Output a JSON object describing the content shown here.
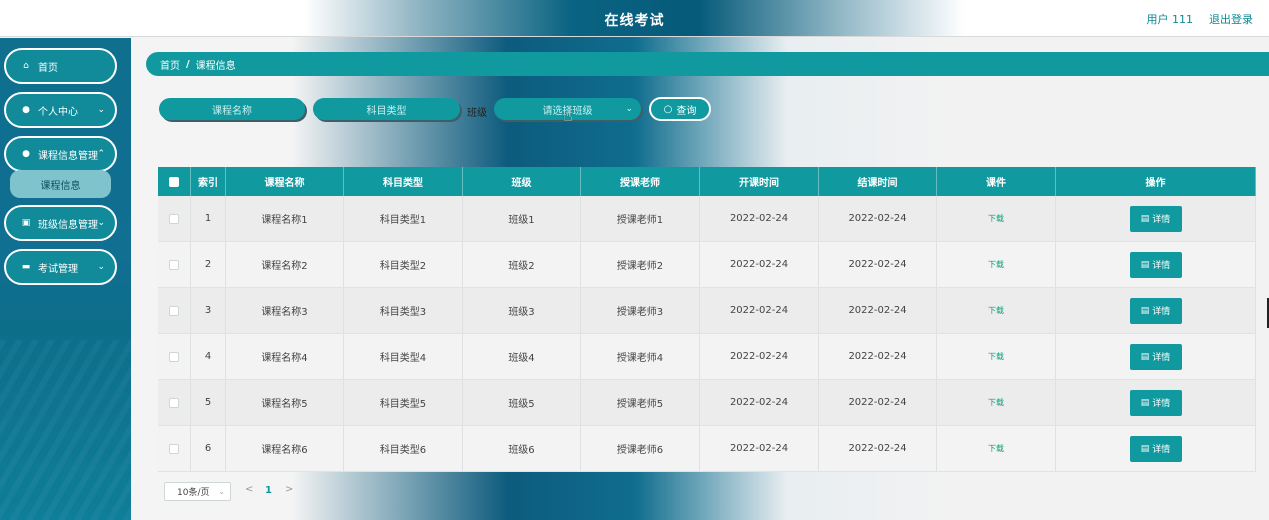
{
  "header": {
    "title": "在线考试",
    "user": "用户 111",
    "logout": "退出登录"
  },
  "sidebar": {
    "items": [
      {
        "label": "首页",
        "icon": "home-icon"
      },
      {
        "label": "个人中心",
        "icon": "user-icon"
      },
      {
        "label": "课程信息管理",
        "icon": "user-icon"
      },
      {
        "label": "班级信息管理",
        "icon": "clipboard-icon"
      },
      {
        "label": "考试管理",
        "icon": "briefcase-icon"
      }
    ],
    "sub_item": "课程信息"
  },
  "breadcrumb": {
    "home": "首页",
    "sep": "/",
    "current": "课程信息"
  },
  "search": {
    "course_name_placeholder": "课程名称",
    "subject_type_placeholder": "科目类型",
    "class_label": "班级",
    "class_select_placeholder": "请选择班级",
    "query_button": "查询"
  },
  "table": {
    "headers": [
      "",
      "索引",
      "课程名称",
      "科目类型",
      "班级",
      "授课老师",
      "开课时间",
      "结课时间",
      "课件",
      "操作"
    ],
    "rows": [
      {
        "index": "1",
        "name": "课程名称1",
        "type": "科目类型1",
        "class": "班级1",
        "teacher": "授课老师1",
        "start": "2022-02-24",
        "end": "2022-02-24",
        "ware": "下载",
        "action": "详情"
      },
      {
        "index": "2",
        "name": "课程名称2",
        "type": "科目类型2",
        "class": "班级2",
        "teacher": "授课老师2",
        "start": "2022-02-24",
        "end": "2022-02-24",
        "ware": "下载",
        "action": "详情"
      },
      {
        "index": "3",
        "name": "课程名称3",
        "type": "科目类型3",
        "class": "班级3",
        "teacher": "授课老师3",
        "start": "2022-02-24",
        "end": "2022-02-24",
        "ware": "下载",
        "action": "详情"
      },
      {
        "index": "4",
        "name": "课程名称4",
        "type": "科目类型4",
        "class": "班级4",
        "teacher": "授课老师4",
        "start": "2022-02-24",
        "end": "2022-02-24",
        "ware": "下载",
        "action": "详情"
      },
      {
        "index": "5",
        "name": "课程名称5",
        "type": "科目类型5",
        "class": "班级5",
        "teacher": "授课老师5",
        "start": "2022-02-24",
        "end": "2022-02-24",
        "ware": "下载",
        "action": "详情"
      },
      {
        "index": "6",
        "name": "课程名称6",
        "type": "科目类型6",
        "class": "班级6",
        "teacher": "授课老师6",
        "start": "2022-02-24",
        "end": "2022-02-24",
        "ware": "下载",
        "action": "详情"
      }
    ]
  },
  "pagination": {
    "page_size": "10条/页",
    "prev": "<",
    "current": "1",
    "next": ">"
  },
  "colors": {
    "accent": "#109aa0",
    "download": "#0aa078",
    "sidebar": "#0e6f8e"
  }
}
